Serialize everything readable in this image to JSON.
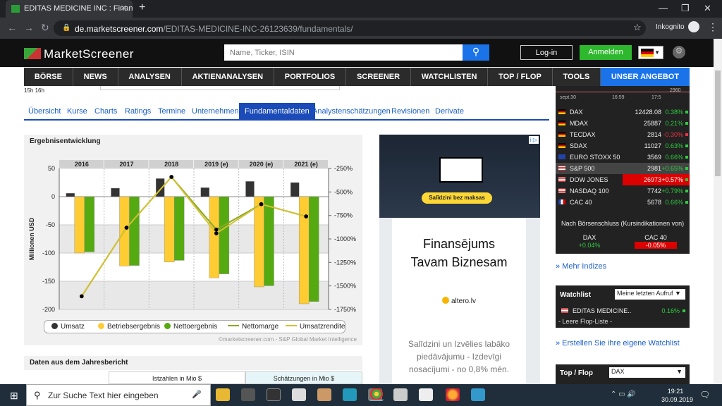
{
  "browser": {
    "tab_title": "EDITAS MEDICINE INC : Finanzda",
    "new_tab": "+",
    "url_host": "de.marketscreener.com",
    "url_path": "/EDITAS-MEDICINE-INC-26123639/fundamentals/",
    "incognito_label": "Inkognito"
  },
  "site": {
    "logo": "MarketScreener",
    "search_placeholder": "Name, Ticker, ISIN",
    "login": "Log-in",
    "register": "Anmelden",
    "nav": [
      "BÖRSE",
      "NEWS",
      "ANALYSEN",
      "AKTIENANALYSEN",
      "PORTFOLIOS",
      "SCREENER",
      "WATCHLISTEN",
      "TOP / FLOP",
      "TOOLS",
      "UNSER ANGEBOT"
    ],
    "time": "15h 16h"
  },
  "subnav": [
    "Übersicht",
    "Kurse",
    "Charts",
    "Ratings",
    "Termine",
    "Unternehmen",
    "Fundamentaldaten",
    "Analystenschätzungen",
    "Revisionen",
    "Derivate"
  ],
  "subnav_active": "Fundamentaldaten",
  "chart_box": {
    "title": "Ergebnisentwicklung",
    "copyright": "©marketscreener.com - S&P Global Market Intelligence"
  },
  "chart_data": {
    "type": "bar",
    "categories": [
      "2016",
      "2017",
      "2018",
      "2019 (e)",
      "2020 (e)",
      "2021 (e)"
    ],
    "ylabel": "Millionen USD",
    "ylim": [
      -200,
      50
    ],
    "y_ticks": [
      50,
      0,
      -50,
      -100,
      -150,
      -200
    ],
    "y2lim": [
      -1750,
      -250
    ],
    "y2_ticks": [
      "-250%",
      "-500%",
      "-750%",
      "-1000%",
      "-1250%",
      "-1500%",
      "-1750%"
    ],
    "grid": true,
    "legend_position": "bottom",
    "series": [
      {
        "name": "Umsatz",
        "kind": "bar",
        "color": "#333333",
        "values": [
          6,
          15,
          32,
          16,
          27,
          25
        ]
      },
      {
        "name": "Betriebsergebnis",
        "kind": "bar",
        "color": "#ffcc33",
        "values": [
          -100,
          -123,
          -116,
          -144,
          -160,
          -190
        ]
      },
      {
        "name": "Nettoergebnis",
        "kind": "bar",
        "color": "#55aa11",
        "values": [
          -98,
          -122,
          -113,
          -137,
          -158,
          -186
        ]
      },
      {
        "name": "Nettomarge",
        "kind": "line",
        "color": "#88aa22",
        "axis": "y2",
        "values": [
          -1610,
          -880,
          -340,
          -900,
          -630,
          -760
        ]
      },
      {
        "name": "Umsatzrendite",
        "kind": "line",
        "color": "#d4c033",
        "axis": "y2",
        "values": [
          -1610,
          -880,
          -340,
          -940,
          -630,
          -760
        ]
      }
    ]
  },
  "report": {
    "title": "Daten aus dem Jahresbericht",
    "col1": "Istzahlen in Mio $",
    "col2": "Schätzungen in Mio $"
  },
  "ad": {
    "choice": "i ▷",
    "button": "Salīdzini bez maksas",
    "headline_1": "Finansējums",
    "headline_2": "Tavam Biznesam",
    "logo": "altero.lv",
    "body": "Salīdzini un Izvēlies labāko piedāvājumu - Izdevīgi nosacījumi - no 0,8% mēn."
  },
  "mini_chart": {
    "labels": [
      "sept.30",
      "16:59",
      "17:5"
    ],
    "value": "2960"
  },
  "indices": [
    {
      "flag": "de",
      "name": "DAX",
      "value": "12428.08",
      "change": "0.38%",
      "neg": false,
      "color": "#2ecc40"
    },
    {
      "flag": "de",
      "name": "MDAX",
      "value": "25887",
      "change": "0.21%",
      "neg": false,
      "color": "#2ecc40"
    },
    {
      "flag": "de",
      "name": "TECDAX",
      "value": "2814",
      "change": "-0.30%",
      "neg": true,
      "color": "#ee3344"
    },
    {
      "flag": "de",
      "name": "SDAX",
      "value": "11027",
      "change": "0.63%",
      "neg": false,
      "color": "#2ecc40"
    },
    {
      "flag": "eu",
      "name": "EURO STOXX 50",
      "value": "3569",
      "change": "0.66%",
      "neg": false,
      "color": "#2ecc40"
    },
    {
      "flag": "us",
      "name": "S&P 500",
      "value": "2981",
      "change": "+0.65%",
      "neg": false,
      "color": "#2ecc40"
    },
    {
      "flag": "us",
      "name": "DOW JONES",
      "value": "26973",
      "change": "+0.57%",
      "neg": false,
      "color": "#ffffff"
    },
    {
      "flag": "us",
      "name": "NASDAQ 100",
      "value": "7742",
      "change": "+0.79%",
      "neg": false,
      "color": "#2ecc40"
    },
    {
      "flag": "fr",
      "name": "CAC 40",
      "value": "5678",
      "change": "0.66%",
      "neg": false,
      "color": "#2ecc40"
    }
  ],
  "after_close": {
    "title": "Nach Börsenschluss (Kursindikationen von)",
    "dax_name": "DAX",
    "dax_change": "+0.04%",
    "cac_name": "CAC 40",
    "cac_change": "-0.05%"
  },
  "more_indices": "» Mehr Indizes",
  "watchlist": {
    "title": "Watchlist",
    "select": "Meine letzten Aufruf ▼",
    "item_name": "EDITAS MEDICINE..",
    "item_change": "0.16%",
    "footer": "- Leere Flop-Liste -"
  },
  "create_watchlist": "» Erstellen Sie ihre eigene Watchlist",
  "topflop": {
    "title": "Top / Flop",
    "select": "DAX"
  },
  "taskbar": {
    "search": "Zur Suche Text hier eingeben",
    "time": "19:21",
    "date": "30.09.2019"
  }
}
